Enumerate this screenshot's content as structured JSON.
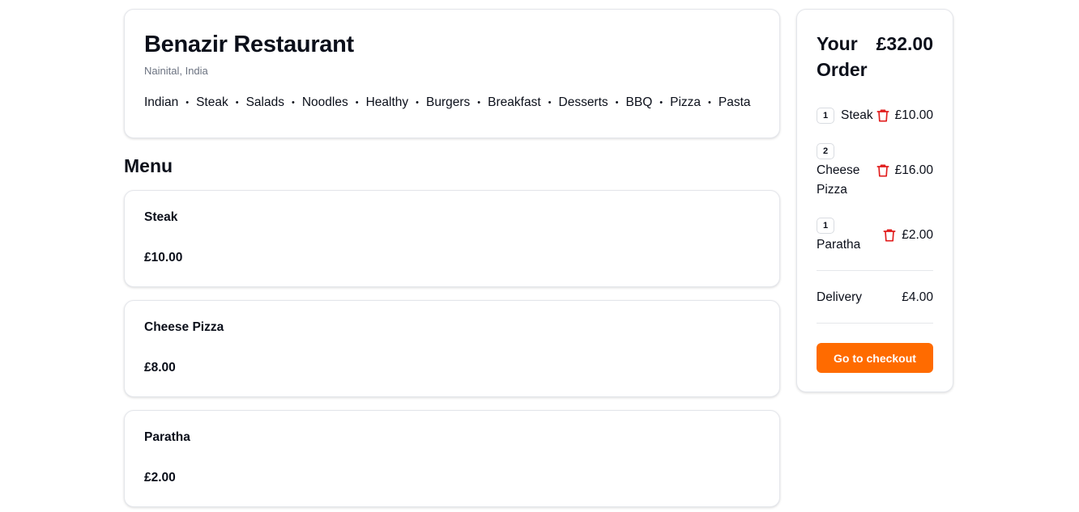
{
  "restaurant": {
    "name": "Benazir Restaurant",
    "location": "Nainital, India",
    "cuisines": [
      "Indian",
      "Steak",
      "Salads",
      "Noodles",
      "Healthy",
      "Burgers",
      "Breakfast",
      "Desserts",
      "BBQ",
      "Pizza",
      "Pasta"
    ],
    "separator": "•"
  },
  "menu": {
    "heading": "Menu",
    "items": [
      {
        "name": "Steak",
        "price": "£10.00"
      },
      {
        "name": "Cheese Pizza",
        "price": "£8.00"
      },
      {
        "name": "Paratha",
        "price": "£2.00"
      }
    ]
  },
  "order": {
    "title": "Your Order",
    "total": "£32.00",
    "lines": [
      {
        "qty": "1",
        "name": "Steak",
        "price": "£10.00",
        "icon": "trash-icon"
      },
      {
        "qty": "2",
        "name": "Cheese Pizza",
        "price": "£16.00",
        "icon": "trash-icon"
      },
      {
        "qty": "1",
        "name": "Paratha",
        "price": "£2.00",
        "icon": "trash-icon"
      }
    ],
    "delivery_label": "Delivery",
    "delivery_price": "£4.00",
    "checkout_label": "Go to checkout"
  },
  "colors": {
    "accent": "#ff6b00",
    "trash": "#e11d1d",
    "muted_text": "#6b7280",
    "border": "#e4e6eb"
  }
}
